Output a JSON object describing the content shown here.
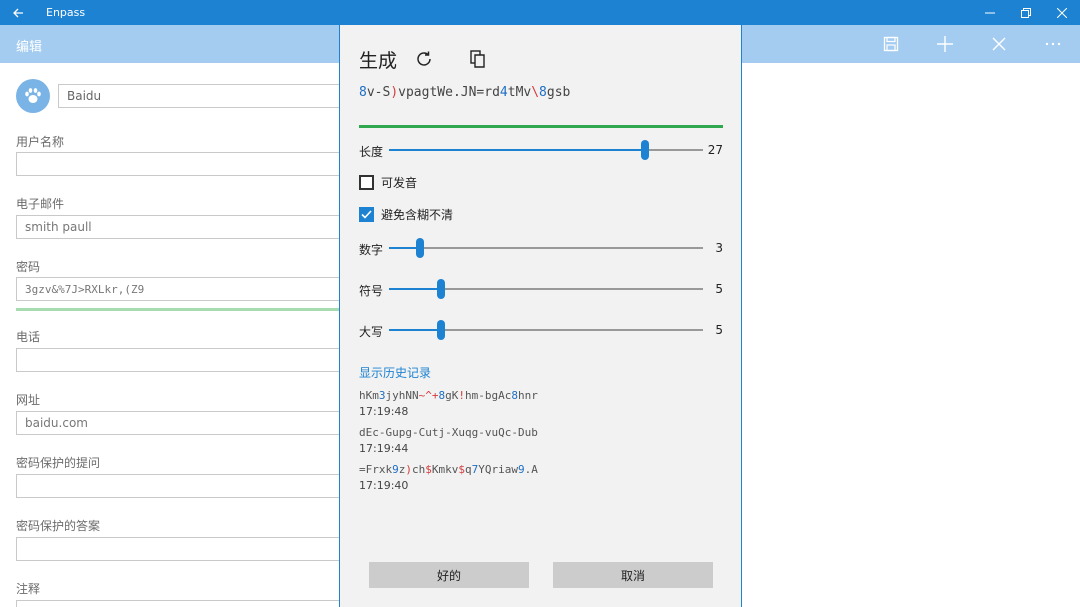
{
  "window": {
    "title": "Enpass"
  },
  "cmdbar": {
    "title": "编辑"
  },
  "form": {
    "name_value": "Baidu",
    "fields": [
      {
        "label": "用户名称",
        "value": ""
      },
      {
        "label": "电子邮件",
        "value": "smith paull"
      },
      {
        "label": "密码",
        "value": "3gzv&%7J>RXLkr,(Z9"
      },
      {
        "label": "电话",
        "value": ""
      },
      {
        "label": "网址",
        "value": "baidu.com"
      },
      {
        "label": "密码保护的提问",
        "value": ""
      },
      {
        "label": "密码保护的答案",
        "value": ""
      },
      {
        "label": "注释",
        "value": ""
      }
    ]
  },
  "dialog": {
    "title": "生成",
    "generated_password": "8v-S)vpagtWe.JN=rd4tMv\\8gsb",
    "length": {
      "label": "长度",
      "value": 27,
      "fraction": 0.815
    },
    "pronounceable": {
      "label": "可发音",
      "checked": false
    },
    "avoid_ambiguous": {
      "label": "避免含糊不清",
      "checked": true
    },
    "digits": {
      "label": "数字",
      "value": 3,
      "fraction": 0.1
    },
    "symbols": {
      "label": "符号",
      "value": 5,
      "fraction": 0.165
    },
    "uppercase": {
      "label": "大写",
      "value": 5,
      "fraction": 0.165
    },
    "history_link": "显示历史记录",
    "history": [
      {
        "password": "hKm3jyhNN~^+8gK!hm-bgAc8hnr",
        "time": "17:19:48"
      },
      {
        "password": "dEc-Gupg-Cutj-Xuqg-vuQc-Dub",
        "time": "17:19:44"
      },
      {
        "password": "=Frxk9z)ch$Kmkv$q7YQriaw9.A",
        "time": "17:19:40"
      }
    ],
    "ok_label": "好的",
    "cancel_label": "取消"
  },
  "colors": {
    "accent": "#1e82d2",
    "digit": "#1e6fc4",
    "symbol": "#d63a3a",
    "strength": "#2fa84f"
  }
}
